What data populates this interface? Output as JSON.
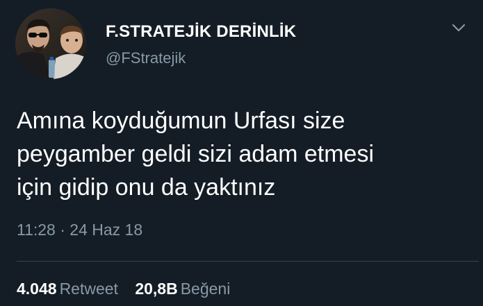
{
  "author": {
    "display_name": "F.STRATEJİK DERİNLİK",
    "handle": "@FStratejik",
    "avatar_icon": "profile-photo"
  },
  "menu": {
    "icon": "chevron-down-icon"
  },
  "tweet": {
    "lines": [
      "Amına koyduğumun Urfası size",
      "peygamber geldi sizi adam etmesi",
      "için gidip onu da yaktınız"
    ],
    "timestamp": "11:28 · 24 Haz 18"
  },
  "stats": {
    "retweet_count": "4.048",
    "retweet_label": "Retweet",
    "like_count": "20,8B",
    "like_label": "Beğeni"
  },
  "colors": {
    "background": "#141d26",
    "text_primary": "#ffffff",
    "text_secondary": "#8899a6",
    "divider": "#38444d"
  }
}
